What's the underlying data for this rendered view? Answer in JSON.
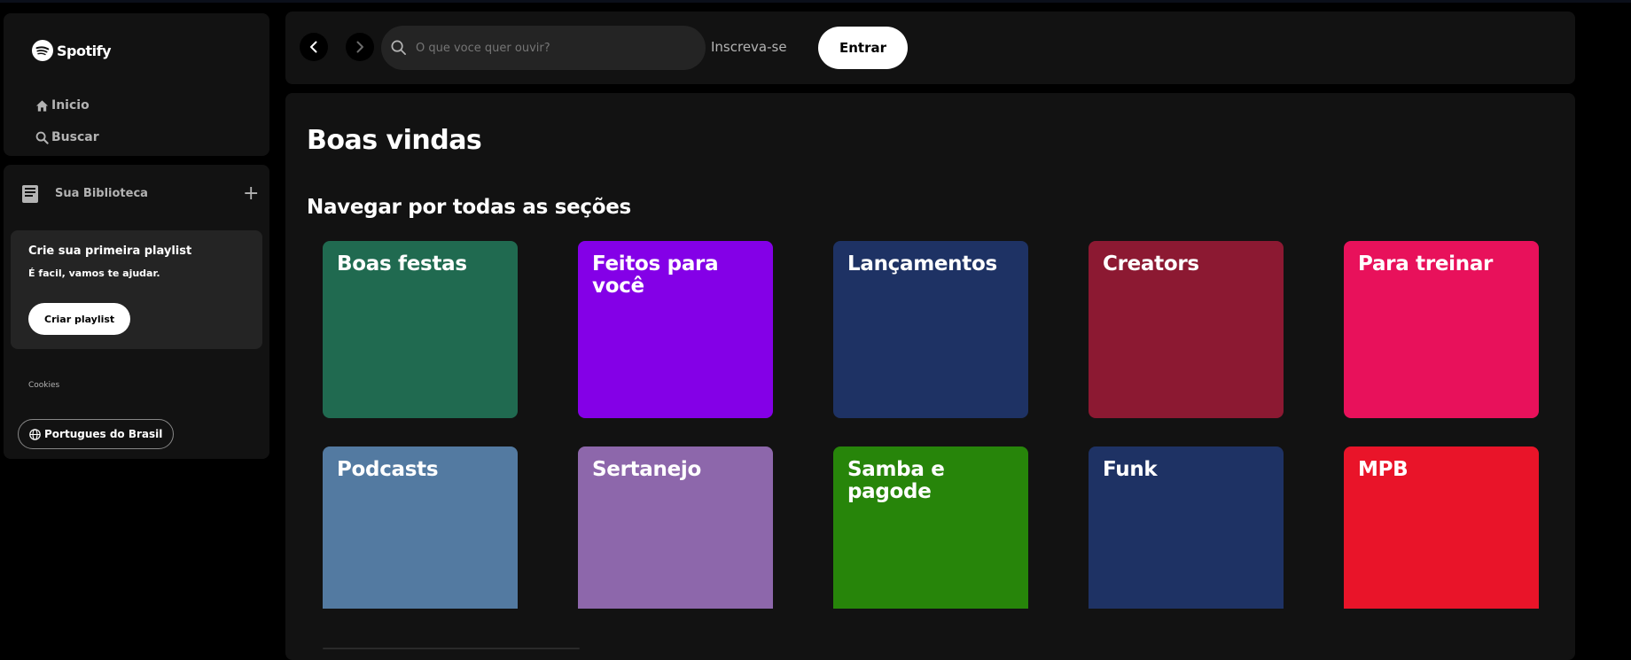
{
  "brand": {
    "name": "Spotify"
  },
  "sidebar": {
    "nav": [
      {
        "label": "Inicio",
        "icon": "home-icon"
      },
      {
        "label": "Buscar",
        "icon": "search-icon"
      }
    ],
    "library": {
      "title": "Sua Biblioteca",
      "add_icon": "plus-icon",
      "playlist_card": {
        "title": "Crie sua primeira playlist",
        "subtitle": "É facil, vamos te ajudar.",
        "button": "Criar playlist"
      },
      "cookies": "Cookies",
      "language": "Portugues do Brasil"
    }
  },
  "header": {
    "search_placeholder": "O que voce quer ouvir?",
    "signup": "Inscreva-se",
    "login": "Entrar"
  },
  "main": {
    "title": "Boas vindas",
    "section_title": "Navegar por todas as seções",
    "categories": [
      {
        "label": "Boas festas",
        "color": "#206A50"
      },
      {
        "label": "Feitos para você",
        "color": "#8400E7"
      },
      {
        "label": "Lançamentos",
        "color": "#1E3264"
      },
      {
        "label": "Creators",
        "color": "#8C1932"
      },
      {
        "label": "Para treinar",
        "color": "#E8115B"
      },
      {
        "label": "Podcasts",
        "color": "#537AA1"
      },
      {
        "label": "Sertanejo",
        "color": "#8D67AB"
      },
      {
        "label": "Samba e pagode",
        "color": "#27850A"
      },
      {
        "label": "Funk",
        "color": "#1E3264"
      },
      {
        "label": "MPB",
        "color": "#E91429"
      }
    ]
  }
}
